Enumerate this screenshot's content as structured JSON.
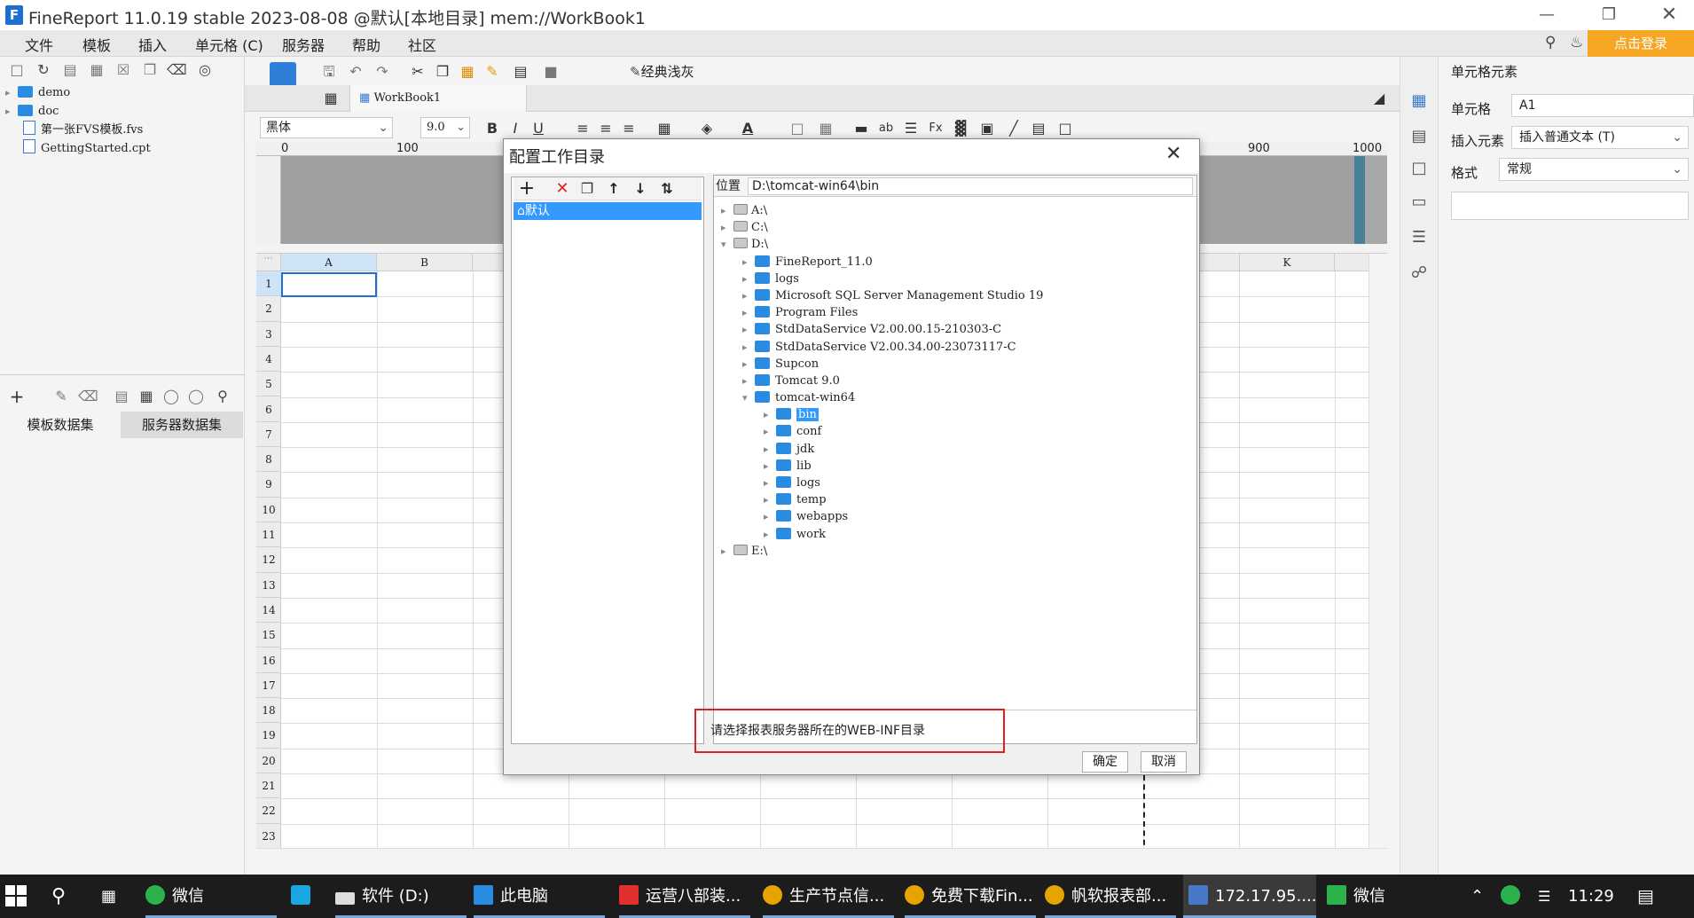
{
  "title_bar": {
    "logo": "F",
    "title": "FineReport 11.0.19 stable 2023-08-08 @默认[本地目录]    mem://WorkBook1"
  },
  "menu": [
    "文件",
    "模板",
    "插入",
    "单元格 (C)",
    "服务器",
    "帮助",
    "社区"
  ],
  "login_button": "点击登录",
  "left_panel": {
    "tree": [
      {
        "label": "demo",
        "type": "folder"
      },
      {
        "label": "doc",
        "type": "folder"
      },
      {
        "label": "第一张FVS模板.fvs",
        "type": "file"
      },
      {
        "label": "GettingStarted.cpt",
        "type": "file"
      }
    ],
    "dataset_tabs": [
      "模板数据集",
      "服务器数据集"
    ]
  },
  "toolbar": {
    "style_button": "经典浅灰",
    "sheet_tab": "WorkBook1",
    "font_name": "黑体",
    "font_size": "9.0"
  },
  "ruler": {
    "labels": [
      "0",
      "100",
      "900",
      "1000"
    ]
  },
  "grid": {
    "columns": [
      "A",
      "B",
      "K"
    ],
    "rows": [
      "1",
      "2",
      "3",
      "4",
      "5",
      "6",
      "7",
      "8",
      "9",
      "10",
      "11",
      "12",
      "13",
      "14",
      "15",
      "16",
      "17",
      "18",
      "19",
      "20",
      "21",
      "22",
      "23"
    ]
  },
  "right_panel": {
    "title": "单元格元素",
    "cell_label": "单元格",
    "cell_value": "A1",
    "insert_label": "插入元素",
    "insert_value": "插入普通文本 (T)",
    "format_label": "格式",
    "format_value": "常规"
  },
  "dialog": {
    "title": "配置工作目录",
    "list_item": "默认",
    "location_label": "位置",
    "location_value": "D:\\tomcat-win64\\bin",
    "tree": [
      {
        "label": "A:\\",
        "level": 0,
        "kind": "drive",
        "expanded": false
      },
      {
        "label": "C:\\",
        "level": 0,
        "kind": "drive",
        "expanded": false
      },
      {
        "label": "D:\\",
        "level": 0,
        "kind": "drive",
        "expanded": true
      },
      {
        "label": "FineReport_11.0",
        "level": 1,
        "kind": "folder"
      },
      {
        "label": "logs",
        "level": 1,
        "kind": "folder"
      },
      {
        "label": "Microsoft SQL Server Management Studio 19",
        "level": 1,
        "kind": "folder"
      },
      {
        "label": "Program Files",
        "level": 1,
        "kind": "folder"
      },
      {
        "label": "StdDataService V2.00.00.15-210303-C",
        "level": 1,
        "kind": "folder"
      },
      {
        "label": "StdDataService V2.00.34.00-23073117-C",
        "level": 1,
        "kind": "folder"
      },
      {
        "label": "Supcon",
        "level": 1,
        "kind": "folder"
      },
      {
        "label": "Tomcat 9.0",
        "level": 1,
        "kind": "folder"
      },
      {
        "label": "tomcat-win64",
        "level": 1,
        "kind": "folder",
        "expanded": true
      },
      {
        "label": "bin",
        "level": 2,
        "kind": "folder",
        "selected": true
      },
      {
        "label": "conf",
        "level": 2,
        "kind": "folder"
      },
      {
        "label": "jdk",
        "level": 2,
        "kind": "folder"
      },
      {
        "label": "lib",
        "level": 2,
        "kind": "folder"
      },
      {
        "label": "logs",
        "level": 2,
        "kind": "folder"
      },
      {
        "label": "temp",
        "level": 2,
        "kind": "folder"
      },
      {
        "label": "webapps",
        "level": 2,
        "kind": "folder"
      },
      {
        "label": "work",
        "level": 2,
        "kind": "folder"
      },
      {
        "label": "E:\\",
        "level": 0,
        "kind": "drive",
        "expanded": false
      }
    ],
    "hint": "请选择报表服务器所在的WEB-INF目录",
    "ok": "确定",
    "cancel": "取消"
  },
  "taskbar": {
    "items": [
      "微信",
      "软件 (D:)",
      "此电脑",
      "运营八部装...",
      "生产节点信...",
      "免费下载Fin...",
      "帆软报表部...",
      "172.17.95....",
      "微信"
    ],
    "time": "11:29"
  },
  "colors": {
    "accent": "#1f6fd1",
    "login": "#f5a623",
    "highlight_border": "#e02020",
    "selection": "#3399ff"
  }
}
